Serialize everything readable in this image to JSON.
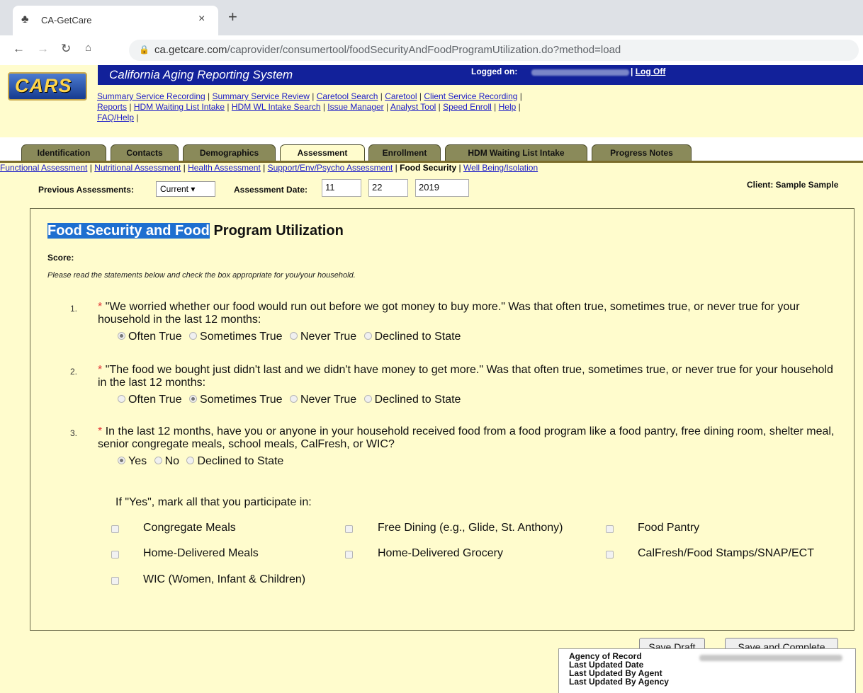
{
  "browser": {
    "tab_title": "CA-GetCare",
    "close_glyph": "×",
    "new_tab_glyph": "+",
    "url_host": "ca.getcare.com",
    "url_path": "/caprovider/consumertool/foodSecurityAndFoodProgramUtilization.do?method=load"
  },
  "header": {
    "logo_text": "CARS",
    "title": "California Aging Reporting System",
    "logged_on_label": "Logged on:",
    "logoff_label": "Log Off",
    "nav_links": [
      "Summary Service Recording",
      "Summary Service Review",
      "Caretool Search",
      "Caretool",
      "Client Service Recording",
      "Reports",
      "HDM Waiting List Intake",
      "HDM WL Intake Search",
      "Issue Manager",
      "Analyst Tool",
      "Speed Enroll",
      "Help",
      "FAQ/Help"
    ]
  },
  "tabs": [
    "Identification",
    "Contacts",
    "Demographics",
    "Assessment",
    "Enrollment",
    "HDM Waiting List Intake",
    "Progress Notes"
  ],
  "active_tab": "Assessment",
  "subnav": [
    "Functional Assessment",
    "Nutritional Assessment",
    "Health Assessment",
    "Support/Env/Psycho Assessment",
    "Food Security",
    "Well Being/Isolation"
  ],
  "active_subnav": "Food Security",
  "toolbar": {
    "previous_label": "Previous Assessments:",
    "previous_value": "Current ▾",
    "date_label": "Assessment Date:",
    "date_month": "11",
    "date_day": "22",
    "date_year": "2019",
    "client_label": "Client: Sample Sample"
  },
  "form": {
    "title_highlight": "Food Security and Food",
    "title_rest": " Program Utilization",
    "score_label": "Score:",
    "instruction": "Please read the statements below and check the box appropriate for you/your household.",
    "required_mark": "*",
    "questions": [
      {
        "number": "1.",
        "text": "\"We worried whether our food would run out before we got money to buy more.\" Was that often true, sometimes true, or never true for your household in the last 12 months:",
        "options": [
          "Often True",
          "Sometimes True",
          "Never True",
          "Declined to State"
        ],
        "selected": "Often True"
      },
      {
        "number": "2.",
        "text": "\"The food we bought just didn't last and we didn't have money to get more.\" Was that often true, sometimes true, or never true for your household in the last 12 months:",
        "options": [
          "Often True",
          "Sometimes True",
          "Never True",
          "Declined to State"
        ],
        "selected": "Sometimes True"
      },
      {
        "number": "3.",
        "text": "In the last 12 months, have you or anyone in your household received food from a food program like a food pantry, free dining room, shelter meal, senior congregate meals, school meals, CalFresh, or WIC?",
        "options": [
          "Yes",
          "No",
          "Declined to State"
        ],
        "selected": "Yes"
      }
    ],
    "if_yes_label": "If \"Yes\", mark all that you participate in:",
    "programs": [
      "Congregate Meals",
      "Free Dining (e.g., Glide, St. Anthony)",
      "Food Pantry",
      "Home-Delivered Meals",
      "Home-Delivered Grocery",
      "CalFresh/Food Stamps/SNAP/ECT",
      "WIC (Women, Infant & Children)"
    ],
    "save_draft_label": "Save Draft",
    "save_complete_label": "Save and Complete"
  },
  "record_meta": {
    "agency_label": "Agency of Record",
    "updated_date_label": "Last Updated Date",
    "updated_agent_label": "Last Updated By Agent",
    "updated_agency_label": "Last Updated By Agency"
  }
}
